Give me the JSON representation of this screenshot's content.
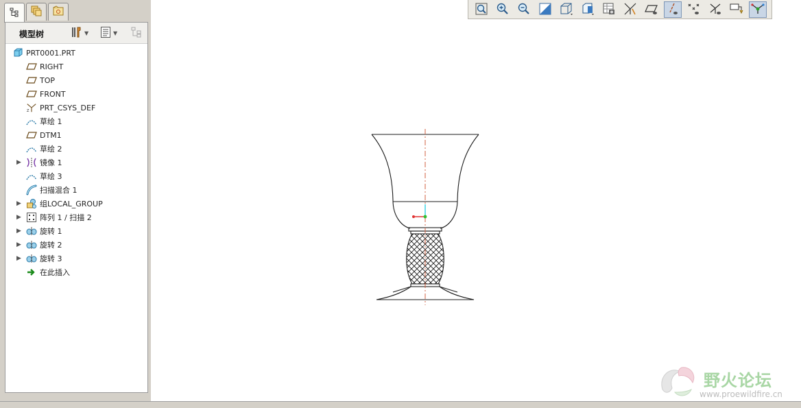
{
  "nav": {
    "tabs": [
      {
        "name": "model-tree-tab-icon"
      },
      {
        "name": "layers-tab-icon"
      },
      {
        "name": "folder-browser-tab-icon"
      }
    ],
    "panel_title": "模型树",
    "settings_icon": "tools-icon",
    "show_icon": "list-icon"
  },
  "tree": {
    "items": [
      {
        "label": "PRT0001.PRT",
        "icon": "part-icon",
        "expandable": false
      },
      {
        "label": "RIGHT",
        "icon": "datum-plane-icon",
        "expandable": false
      },
      {
        "label": "TOP",
        "icon": "datum-plane-icon",
        "expandable": false
      },
      {
        "label": "FRONT",
        "icon": "datum-plane-icon",
        "expandable": false
      },
      {
        "label": "PRT_CSYS_DEF",
        "icon": "csys-icon",
        "expandable": false
      },
      {
        "label": "草绘 1",
        "icon": "sketch-icon",
        "expandable": false
      },
      {
        "label": "DTM1",
        "icon": "datum-plane-icon",
        "expandable": false
      },
      {
        "label": "草绘 2",
        "icon": "sketch-icon",
        "expandable": false
      },
      {
        "label": "镜像 1",
        "icon": "mirror-icon",
        "expandable": true
      },
      {
        "label": "草绘 3",
        "icon": "sketch-icon",
        "expandable": false
      },
      {
        "label": "扫描混合 1",
        "icon": "swept-blend-icon",
        "expandable": false
      },
      {
        "label": "组LOCAL_GROUP",
        "icon": "group-icon",
        "expandable": true
      },
      {
        "label": "阵列 1 / 扫描 2",
        "icon": "pattern-icon",
        "expandable": true
      },
      {
        "label": "旋转 1",
        "icon": "revolve-icon",
        "expandable": true
      },
      {
        "label": "旋转 2",
        "icon": "revolve-icon",
        "expandable": true
      },
      {
        "label": "旋转 3",
        "icon": "revolve-icon",
        "expandable": true
      },
      {
        "label": "在此插入",
        "icon": "insert-here-arrow-icon",
        "expandable": false
      }
    ]
  },
  "toolbar": {
    "buttons": [
      {
        "name": "refit-icon"
      },
      {
        "name": "zoom-in-icon"
      },
      {
        "name": "zoom-out-icon"
      },
      {
        "name": "repaint-icon"
      },
      {
        "name": "display-style-icon"
      },
      {
        "name": "saved-views-icon"
      },
      {
        "name": "view-manager-icon"
      },
      {
        "name": "datum-display-icon"
      },
      {
        "name": "plane-display-icon"
      },
      {
        "name": "axis-display-icon",
        "pressed": true
      },
      {
        "name": "point-display-icon"
      },
      {
        "name": "csys-display-icon"
      },
      {
        "name": "annotation-display-icon"
      },
      {
        "name": "spin-center-icon",
        "pressed": true
      }
    ]
  },
  "watermark": {
    "text": "野火论坛",
    "url": "www.proewildfire.cn"
  },
  "colors": {
    "panel_bg": "#d4d0c8",
    "tree_bg": "#ffffff",
    "model_line": "#1a1a1a",
    "axis_line": "#d06040",
    "csys_x": "#e03030",
    "csys_y": "#30c030",
    "csys_z": "#30d0e0"
  }
}
